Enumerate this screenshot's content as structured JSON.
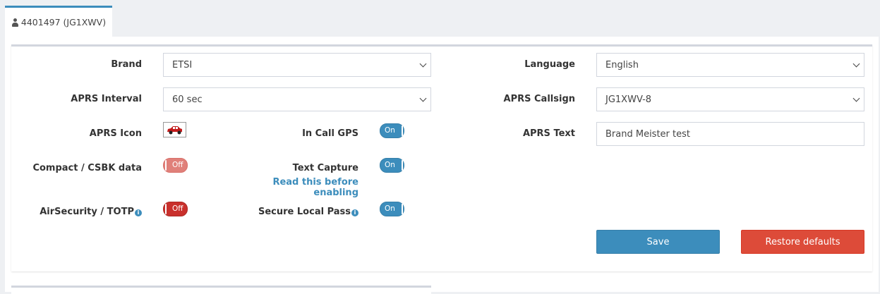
{
  "tab": {
    "label": "4401497 (JG1XWV)",
    "icon": "user-icon"
  },
  "form": {
    "brand": {
      "label": "Brand",
      "value": "ETSI"
    },
    "language": {
      "label": "Language",
      "value": "English"
    },
    "aprs_interval": {
      "label": "APRS Interval",
      "value": "60 sec"
    },
    "aprs_callsign": {
      "label": "APRS Callsign",
      "value": "JG1XWV-8"
    },
    "aprs_icon": {
      "label": "APRS Icon",
      "icon": "car-icon"
    },
    "in_call_gps": {
      "label": "In Call GPS",
      "state": "On"
    },
    "aprs_text": {
      "label": "APRS Text",
      "value": "Brand Meister test"
    },
    "compact_csbk": {
      "label": "Compact / CSBK data",
      "state": "Off"
    },
    "text_capture": {
      "label": "Text Capture",
      "state": "On",
      "link": "Read this before enabling"
    },
    "air_security": {
      "label": "AirSecurity / TOTP",
      "state": "Off"
    },
    "secure_local_pass": {
      "label": "Secure Local Pass",
      "state": "On"
    }
  },
  "buttons": {
    "save": "Save",
    "restore": "Restore defaults"
  },
  "colors": {
    "primary": "#3c8dbc",
    "danger": "#dd4b39",
    "off_light": "#e0807a",
    "off_dark": "#c9302c"
  }
}
